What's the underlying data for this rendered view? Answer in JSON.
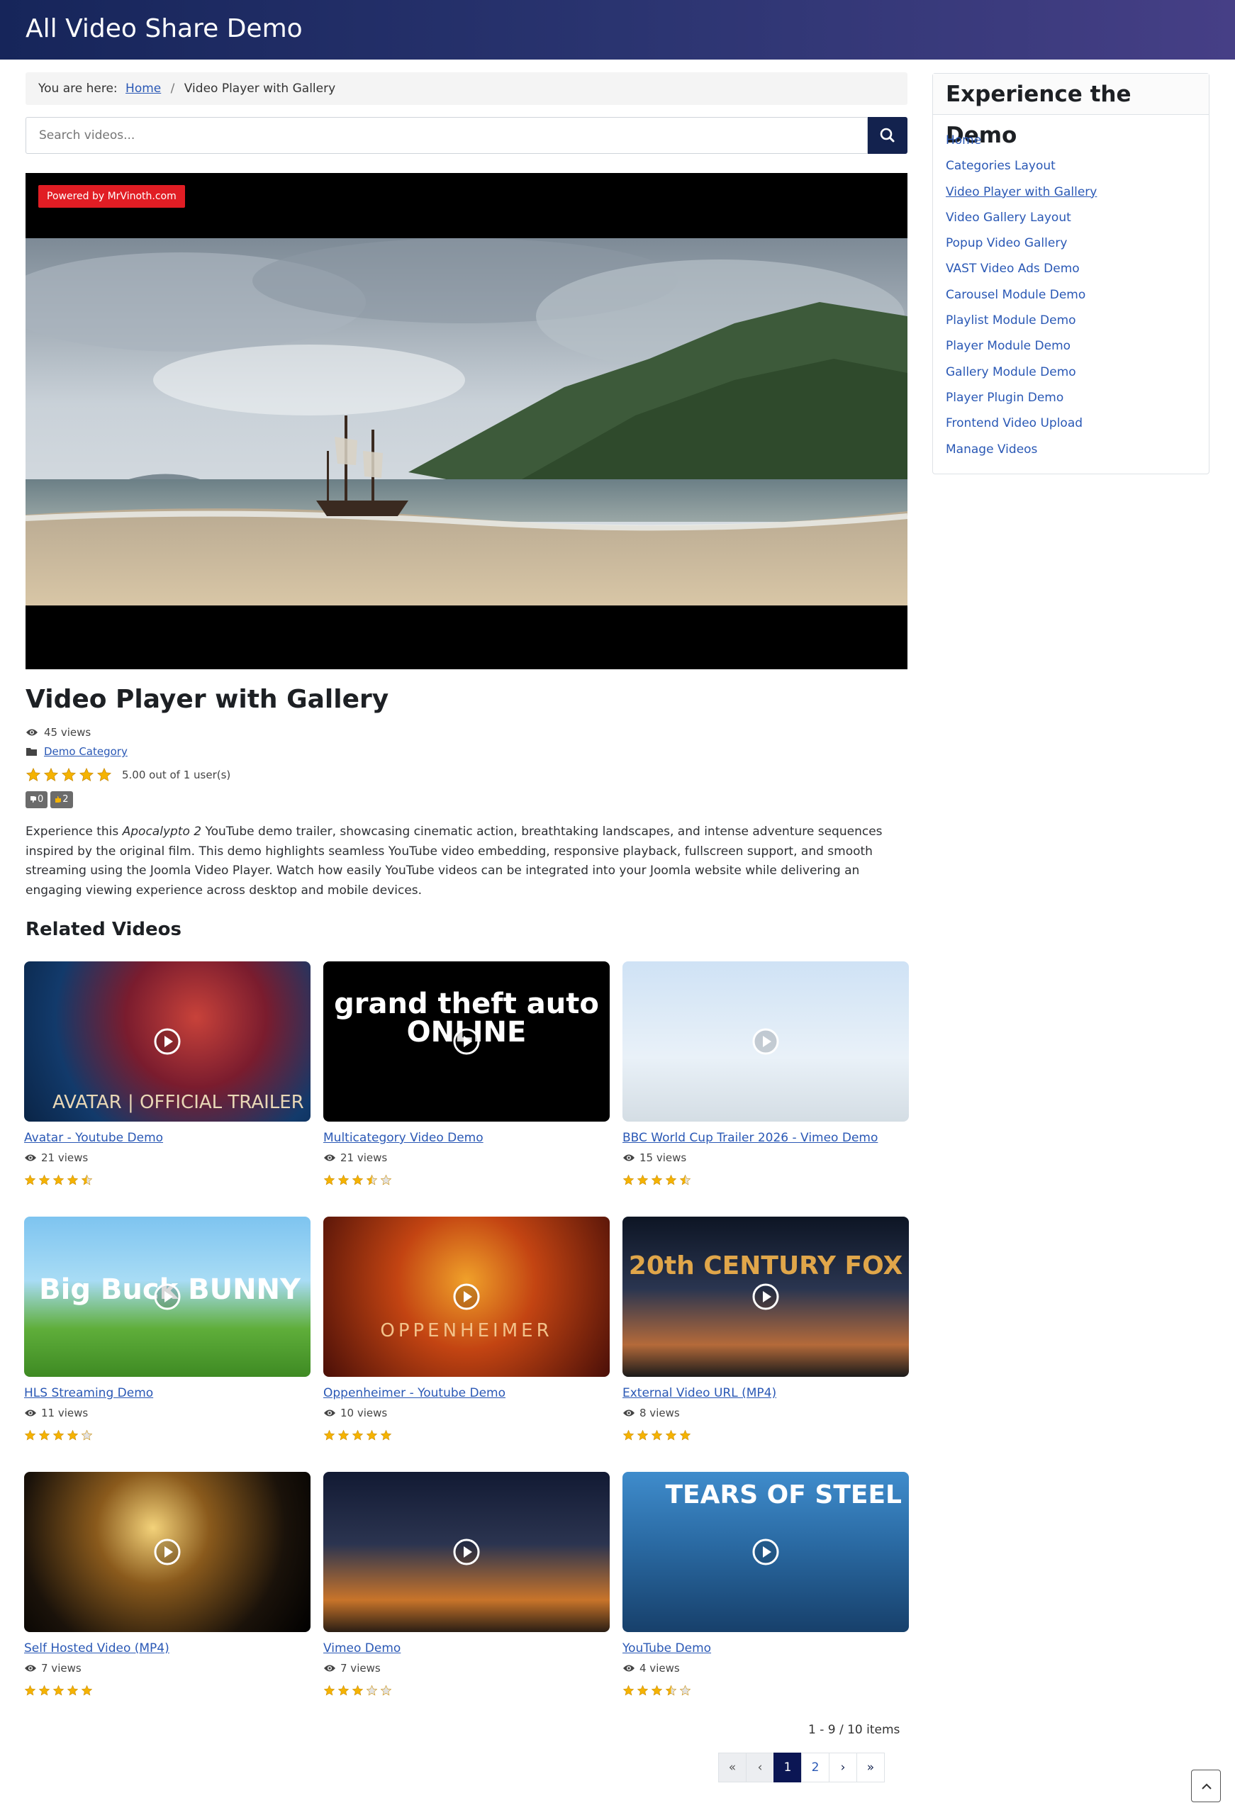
{
  "site": {
    "brand": "All Video Share Demo"
  },
  "breadcrumb": {
    "prefix": "You are here:",
    "home": "Home",
    "current": "Video Player with Gallery"
  },
  "search": {
    "placeholder": "Search videos..."
  },
  "player": {
    "badge": "Powered by MrVinoth.com"
  },
  "video": {
    "title": "Video Player with Gallery",
    "views": "45 views",
    "category": "Demo Category",
    "rating_text": "5.00 out of 1 user(s)",
    "rating": 5,
    "dislikes": "0",
    "likes": "2",
    "description_before": "Experience this ",
    "description_em": "Apocalypto 2",
    "description_after": " YouTube demo trailer, showcasing cinematic action, breathtaking landscapes, and intense adventure sequences inspired by the original film. This demo highlights seamless YouTube video embedding, responsive playback, fullscreen support, and smooth streaming using the Joomla Video Player. Watch how easily YouTube videos can be integrated into your Joomla website while delivering an engaging viewing experience across desktop and mobile devices."
  },
  "related": {
    "heading": "Related Videos",
    "items": [
      {
        "title": "Avatar - Youtube Demo",
        "views": "21 views",
        "rating": 4.5,
        "thumb_text": "AVATAR | OFFICIAL TRAILER"
      },
      {
        "title": "Multicategory Video Demo",
        "views": "21 views",
        "rating": 3.5,
        "thumb_text": "grand theft auto ONLINE"
      },
      {
        "title": "BBC World Cup Trailer 2026 - Vimeo Demo",
        "views": "15 views",
        "rating": 4.5,
        "thumb_text": ""
      },
      {
        "title": "HLS Streaming Demo",
        "views": "11 views",
        "rating": 4,
        "thumb_text": "Big Buck BUNNY"
      },
      {
        "title": "Oppenheimer - Youtube Demo",
        "views": "10 views",
        "rating": 5,
        "thumb_text": "OPPENHEIMER"
      },
      {
        "title": "External Video URL (MP4)",
        "views": "8 views",
        "rating": 5,
        "thumb_text": "20th CENTURY FOX"
      },
      {
        "title": "Self Hosted Video (MP4)",
        "views": "7 views",
        "rating": 5,
        "thumb_text": ""
      },
      {
        "title": "Vimeo Demo",
        "views": "7 views",
        "rating": 3,
        "thumb_text": ""
      },
      {
        "title": "YouTube Demo",
        "views": "4 views",
        "rating": 3.5,
        "thumb_text": "TEARS OF STEEL"
      }
    ]
  },
  "pagination": {
    "info": "1 - 9 / 10 items",
    "pages": [
      "1",
      "2"
    ],
    "current": "1"
  },
  "sidebar": {
    "heading": "Experience the Demo",
    "items": [
      "Home",
      "Categories Layout",
      "Video Player with Gallery",
      "Video Gallery Layout",
      "Popup Video Gallery",
      "VAST Video Ads Demo",
      "Carousel Module Demo",
      "Playlist Module Demo",
      "Player Module Demo",
      "Gallery Module Demo",
      "Player Plugin Demo",
      "Frontend Video Upload",
      "Manage Videos"
    ],
    "active": "Video Player with Gallery"
  },
  "colors": {
    "brand_start": "#16255a",
    "brand_end": "#463f86",
    "link": "#2a58b5",
    "badge": "#e11d24",
    "star": "#f5b301"
  },
  "icons": {
    "search": "search-icon",
    "eye": "eye-icon",
    "folder": "folder-icon",
    "play": "play-icon",
    "thumbs_up": "thumbs-up-icon",
    "thumbs_down": "thumbs-down-icon",
    "back_to_top": "chevron-up-icon"
  }
}
